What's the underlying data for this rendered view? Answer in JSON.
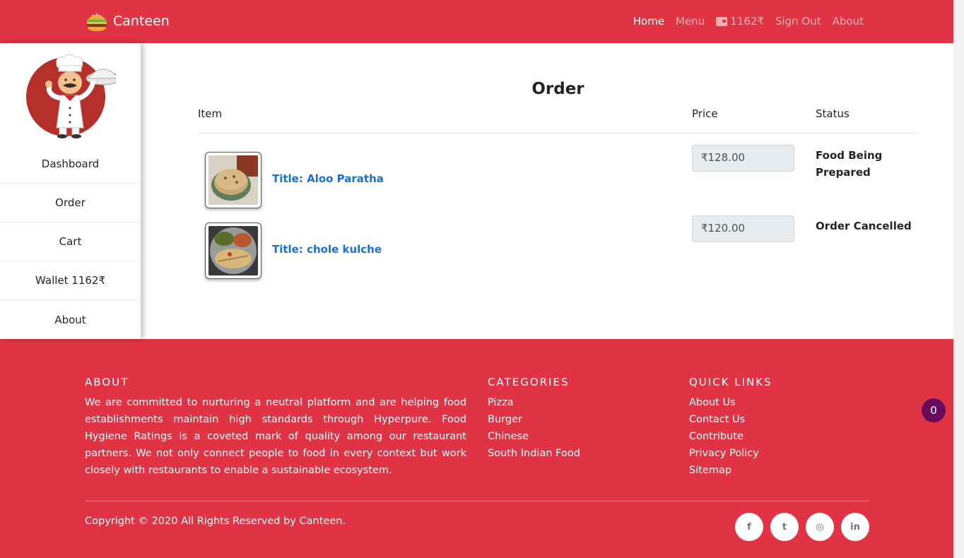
{
  "navbar": {
    "brand": "Canteen",
    "links": [
      {
        "label": "Home"
      },
      {
        "label": "Menu"
      },
      {
        "label": "1162₹"
      },
      {
        "label": "Sign Out"
      },
      {
        "label": "About"
      }
    ],
    "colors": {
      "bg": "#e03444"
    }
  },
  "sidebar": {
    "items": [
      {
        "label": "Dashboard"
      },
      {
        "label": "Order"
      },
      {
        "label": "Cart"
      },
      {
        "label": "Wallet 1162₹"
      },
      {
        "label": "About"
      }
    ]
  },
  "order": {
    "title": "Order",
    "columns": {
      "item": "Item",
      "price": "Price",
      "status": "Status"
    },
    "rows": [
      {
        "title": "Title: Aloo Paratha",
        "price": "₹128.00",
        "status": "Food Being Prepared"
      },
      {
        "title": "Title: chole kulche",
        "price": "₹120.00",
        "status": "Order Cancelled"
      }
    ]
  },
  "footer": {
    "about": {
      "title": "ABOUT",
      "text": "We are committed to nurturing a neutral platform and are helping food establishments maintain high standards through Hyperpure. Food Hygiene Ratings is a coveted mark of quality among our restaurant partners. We not only connect people to food in every context but work closely with restaurants to enable a sustainable ecosystem."
    },
    "categories": {
      "title": "CATEGORIES",
      "items": [
        "Pizza",
        "Burger",
        "Chinese",
        "South Indian Food"
      ]
    },
    "quick_links": {
      "title": "QUICK LINKS",
      "items": [
        "About Us",
        "Contact Us",
        "Contribute",
        "Privacy Policy",
        "Sitemap"
      ]
    },
    "copyright": "Copyright © 2020 All Rights Reserved by Canteen.",
    "socials": [
      {
        "icon": "facebook-icon",
        "glyph": "f"
      },
      {
        "icon": "twitter-icon",
        "glyph": "t"
      },
      {
        "icon": "dribbble-icon",
        "glyph": "◎"
      },
      {
        "icon": "linkedin-icon",
        "glyph": "in"
      }
    ]
  },
  "cart_badge": {
    "count": "0",
    "color": "#6a0a5a"
  }
}
